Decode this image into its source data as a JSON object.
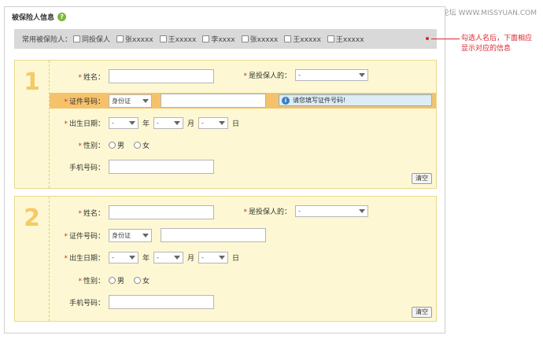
{
  "watermark": "思缘设计论坛  WWW.MISSYUAN.COM",
  "panel": {
    "title": "被保险人信息",
    "help_icon": "help-icon"
  },
  "common_bar": {
    "label": "常用被保险人：",
    "persons": [
      "同投保人",
      "张xxxxx",
      "王xxxxx",
      "李xxxx",
      "张xxxxx",
      "王xxxxx",
      "王xxxxx"
    ]
  },
  "annotation": {
    "line1": "勾选人名后，下面相应",
    "line2": "显示对应的信息"
  },
  "form_labels": {
    "name": "姓名：",
    "is_policyholder": "是投保人的：",
    "id_number": "证件号码：",
    "birth": "出生日期：",
    "gender": "性别：",
    "mobile": "手机号码：",
    "year": "年",
    "month": "月",
    "day": "日",
    "male": "男",
    "female": "女",
    "clear": "清空",
    "required_mark": "*"
  },
  "sections": [
    {
      "number": "1",
      "relation_value": "-",
      "id_type": "身份证",
      "hint": "请您填写证件号码!",
      "year_value": "-",
      "month_value": "-",
      "day_value": "-"
    },
    {
      "number": "2",
      "relation_value": "-",
      "id_type": "身份证",
      "year_value": "-",
      "month_value": "-",
      "day_value": "-"
    }
  ],
  "colors": {
    "accent_red": "#d9262c",
    "section_bg": "#fdf8d3",
    "highlight": "#f5c26b",
    "number_color": "#f5c966"
  }
}
